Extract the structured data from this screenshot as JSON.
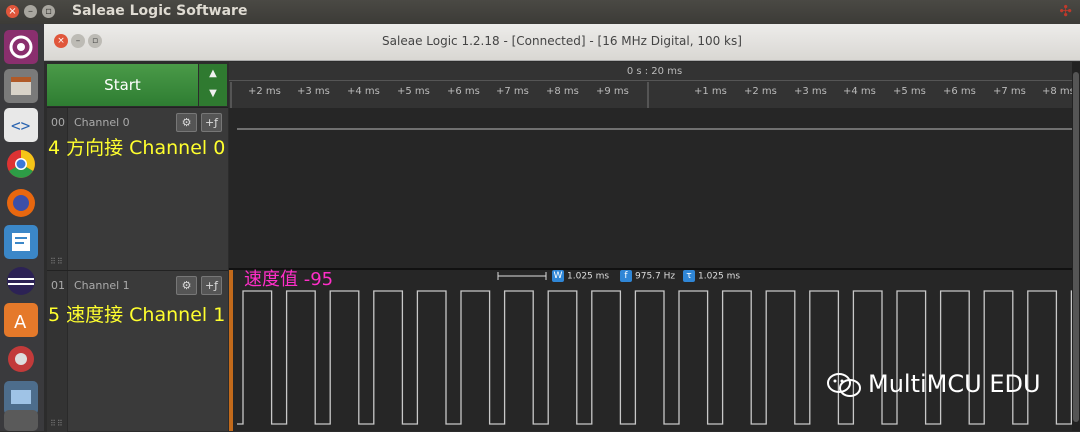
{
  "top_bar": {
    "app_title": "Saleae Logic Software",
    "logo_char": "✣"
  },
  "window": {
    "title": "Saleae Logic 1.2.18 - [Connected] - [16 MHz Digital, 100 ks]"
  },
  "controls": {
    "start_label": "Start",
    "up_arrow": "▲",
    "down_arrow": "▼"
  },
  "timeline": {
    "header": "0 s : 20 ms",
    "ticks": [
      "+2 ms",
      "+3 ms",
      "+4 ms",
      "+5 ms",
      "+6 ms",
      "+7 ms",
      "+8 ms",
      "+9 ms",
      "+1 ms",
      "+2 ms",
      "+3 ms",
      "+4 ms",
      "+5 ms",
      "+6 ms",
      "+7 ms",
      "+8 ms"
    ]
  },
  "channels": [
    {
      "number": "00",
      "name": "Channel 0",
      "annotation": "4 方向接 Channel 0",
      "gear": "⚙",
      "trigger": "+ƒ"
    },
    {
      "number": "01",
      "name": "Channel 1",
      "annotation": "5 速度接 Channel 1",
      "gear": "⚙",
      "trigger": "+ƒ"
    }
  ],
  "speed_annotation": "速度值 -95",
  "measurements": {
    "width_badge": "W",
    "width_value": "1.025 ms",
    "freq_badge": "f",
    "freq_value": "975.7 Hz",
    "period_badge": "τ",
    "period_value": "1.025 ms"
  },
  "watermark": "MultiMCU EDU",
  "colors": {
    "start_green": "#2e7d32",
    "annotation_yellow": "#ffff2e",
    "speed_magenta": "#ff2ec8",
    "marker_orange": "#c26a1b",
    "badge_blue": "#2f86d6"
  }
}
